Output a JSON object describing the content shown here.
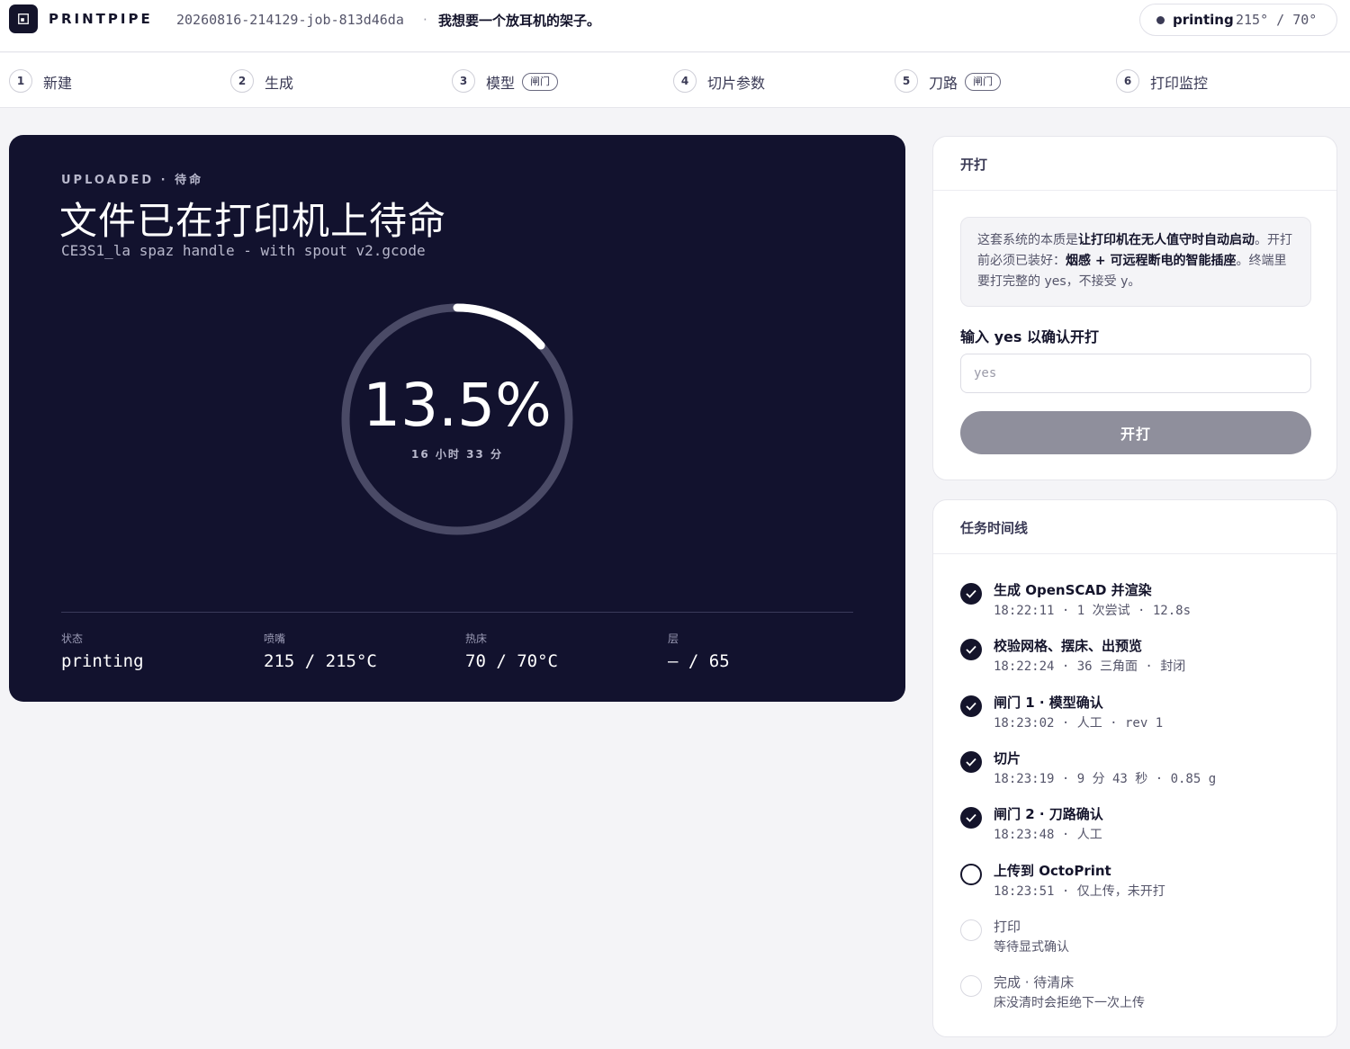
{
  "header": {
    "brand": "PRINTPIPE",
    "job_id": "20260816-214129-job-813d46da",
    "separator": "·",
    "job_description": "我想要一个放耳机的架子。",
    "status": {
      "label": "printing",
      "temps": "215° / 70°"
    }
  },
  "steps": [
    {
      "num": "1",
      "label": "新建"
    },
    {
      "num": "2",
      "label": "生成"
    },
    {
      "num": "3",
      "label": "模型",
      "tag": "闸门"
    },
    {
      "num": "4",
      "label": "切片参数"
    },
    {
      "num": "5",
      "label": "刀路",
      "tag": "闸门"
    },
    {
      "num": "6",
      "label": "打印监控"
    }
  ],
  "hero": {
    "eyebrow": "UPLOADED · 待命",
    "title": "文件已在打印机上待命",
    "file_name": "CE3S1_la spaz handle - with spout v2.gcode",
    "progress_text": "13.5%",
    "progress_value": 13.5,
    "eta": "16 小时 33 分",
    "stats": [
      {
        "label": "状态",
        "value": "printing"
      },
      {
        "label": "喷嘴",
        "value": "215 / 215°C"
      },
      {
        "label": "热床",
        "value": "70 / 70°C"
      },
      {
        "label": "层",
        "value": "— / 65"
      }
    ]
  },
  "start_card": {
    "title": "开打",
    "notice_part1": "这套系统的本质是",
    "notice_bold1": "让打印机在无人值守时自动启动",
    "notice_part2": "。开打前必须已装好：",
    "notice_bold2": "烟感 + 可远程断电的智能插座",
    "notice_part3": "。终端里要打完整的 yes，不接受 y。",
    "confirm_label": "输入 yes 以确认开打",
    "input_placeholder": "yes",
    "button_label": "开打"
  },
  "timeline": {
    "title": "任务时间线",
    "items": [
      {
        "title": "生成 OpenSCAD 并渲染",
        "meta": "18:22:11 · 1 次尝试 · 12.8s",
        "state": "done"
      },
      {
        "title": "校验网格、摆床、出预览",
        "meta": "18:22:24 · 36 三角面 · 封闭",
        "state": "done"
      },
      {
        "title": "闸门 1 · 模型确认",
        "meta": "18:23:02 · 人工 · rev 1",
        "state": "done"
      },
      {
        "title": "切片",
        "meta": "18:23:19 · 9 分 43 秒 · 0.85 g",
        "state": "done"
      },
      {
        "title": "闸门 2 · 刀路确认",
        "meta": "18:23:48 · 人工",
        "state": "done"
      },
      {
        "title": "上传到 OctoPrint",
        "meta": "18:23:51 · 仅上传，未开打",
        "state": "active"
      },
      {
        "title": "打印",
        "meta": "等待显式确认",
        "state": "pending"
      },
      {
        "title": "完成 · 待清床",
        "meta": "床没清时会拒绝下一次上传",
        "state": "pending"
      }
    ]
  }
}
